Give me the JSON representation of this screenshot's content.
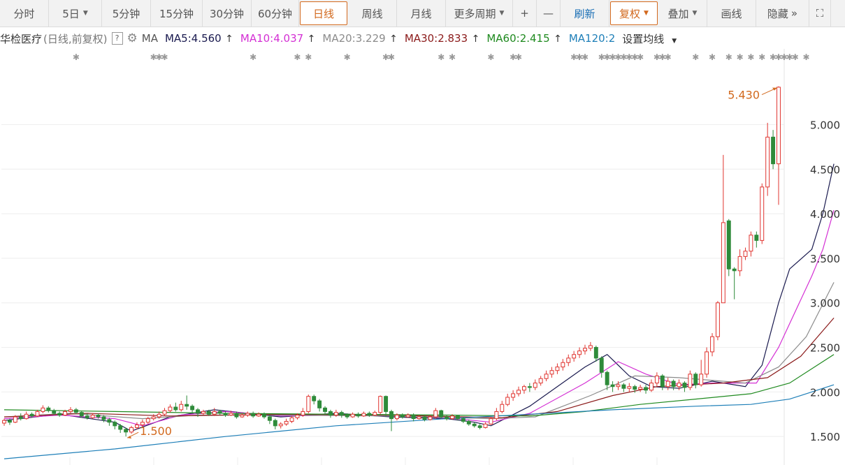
{
  "toolbar": {
    "items": [
      {
        "label": "分时",
        "name": "tab-intraday",
        "caret": false
      },
      {
        "label": "5日",
        "name": "tab-5day",
        "caret": true
      },
      {
        "label": "5分钟",
        "name": "tab-5min",
        "caret": false
      },
      {
        "label": "15分钟",
        "name": "tab-15min",
        "caret": false
      },
      {
        "label": "30分钟",
        "name": "tab-30min",
        "caret": false
      },
      {
        "label": "60分钟",
        "name": "tab-60min",
        "caret": false
      },
      {
        "label": "日线",
        "name": "tab-daily",
        "caret": false,
        "active": true
      },
      {
        "label": "周线",
        "name": "tab-weekly",
        "caret": false
      },
      {
        "label": "月线",
        "name": "tab-monthly",
        "caret": false
      },
      {
        "label": "更多周期",
        "name": "more-periods-dropdown",
        "caret": true
      },
      {
        "label": "+",
        "name": "zoom-in-button",
        "caret": false
      },
      {
        "label": "—",
        "name": "zoom-out-button",
        "caret": false
      },
      {
        "label": "刷新",
        "name": "refresh-button",
        "caret": false,
        "blue": true
      },
      {
        "label": "复权",
        "name": "adjust-dropdown",
        "caret": true,
        "fq": true
      },
      {
        "label": "叠加",
        "name": "overlay-dropdown",
        "caret": true
      },
      {
        "label": "画线",
        "name": "draw-line-button",
        "caret": false
      },
      {
        "label": "隐藏",
        "name": "hide-button",
        "caret": false,
        "chevron": "»"
      },
      {
        "label": "⛶",
        "name": "fullscreen-icon",
        "caret": false
      }
    ]
  },
  "indicator_bar": {
    "stock_name": "华检医疗",
    "mode": "(日线,前复权)",
    "help": "?",
    "ma_label": "MA",
    "ma_items": [
      {
        "text": "MA5:4.560",
        "color": "#1a1a4f",
        "arrow": "↑"
      },
      {
        "text": "MA10:4.037",
        "color": "#d42fd4",
        "arrow": "↑"
      },
      {
        "text": "MA20:3.229",
        "color": "#8c8c8c",
        "arrow": "↑"
      },
      {
        "text": "MA30:2.833",
        "color": "#8b1a1a",
        "arrow": "↑"
      },
      {
        "text": "MA60:2.415",
        "color": "#1f8a1f",
        "arrow": "↑"
      },
      {
        "text": "MA120:2",
        "color": "#1e7fb8",
        "arrow": ""
      }
    ],
    "settings_label": "设置均线"
  },
  "chart_data": {
    "type": "candlestick",
    "ylim": [
      1.18,
      5.85
    ],
    "yticks": [
      "1.500",
      "2.000",
      "2.500",
      "3.000",
      "3.500",
      "4.000",
      "4.500",
      "5.000"
    ],
    "high_label": "5.430",
    "low_label": "1.500",
    "colors": {
      "up": "#e0342f",
      "down": "#2e8b3a",
      "doji": "#333333"
    },
    "candles": [
      [
        1.65,
        1.68,
        1.62,
        1.7
      ],
      [
        1.68,
        1.66,
        1.63,
        1.7
      ],
      [
        1.66,
        1.72,
        1.65,
        1.74
      ],
      [
        1.72,
        1.7,
        1.68,
        1.76
      ],
      [
        1.7,
        1.75,
        1.69,
        1.78
      ],
      [
        1.75,
        1.73,
        1.71,
        1.77
      ],
      [
        1.73,
        1.78,
        1.72,
        1.8
      ],
      [
        1.78,
        1.82,
        1.76,
        1.85
      ],
      [
        1.82,
        1.79,
        1.77,
        1.84
      ],
      [
        1.79,
        1.76,
        1.74,
        1.81
      ],
      [
        1.76,
        1.74,
        1.72,
        1.78
      ],
      [
        1.74,
        1.78,
        1.73,
        1.8
      ],
      [
        1.78,
        1.8,
        1.76,
        1.83
      ],
      [
        1.8,
        1.77,
        1.75,
        1.82
      ],
      [
        1.77,
        1.73,
        1.71,
        1.79
      ],
      [
        1.73,
        1.71,
        1.69,
        1.76
      ],
      [
        1.71,
        1.74,
        1.7,
        1.76
      ],
      [
        1.74,
        1.72,
        1.7,
        1.76
      ],
      [
        1.72,
        1.69,
        1.66,
        1.74
      ],
      [
        1.69,
        1.66,
        1.62,
        1.71
      ],
      [
        1.66,
        1.62,
        1.58,
        1.68
      ],
      [
        1.62,
        1.58,
        1.54,
        1.64
      ],
      [
        1.58,
        1.55,
        1.5,
        1.6
      ],
      [
        1.55,
        1.6,
        1.53,
        1.62
      ],
      [
        1.6,
        1.63,
        1.58,
        1.66
      ],
      [
        1.63,
        1.66,
        1.61,
        1.69
      ],
      [
        1.66,
        1.7,
        1.64,
        1.72
      ],
      [
        1.7,
        1.72,
        1.68,
        1.75
      ],
      [
        1.72,
        1.75,
        1.7,
        1.78
      ],
      [
        1.75,
        1.79,
        1.73,
        1.82
      ],
      [
        1.79,
        1.83,
        1.77,
        1.86
      ],
      [
        1.83,
        1.8,
        1.78,
        1.88
      ],
      [
        1.8,
        1.86,
        1.78,
        1.9
      ],
      [
        1.86,
        1.84,
        1.8,
        1.96
      ],
      [
        1.84,
        1.8,
        1.76,
        1.86
      ],
      [
        1.8,
        1.76,
        1.72,
        1.82
      ],
      [
        1.76,
        1.78,
        1.74,
        1.8
      ],
      [
        1.78,
        1.75,
        1.73,
        1.8
      ],
      [
        1.75,
        1.78,
        1.73,
        1.82
      ],
      [
        1.78,
        1.76,
        1.74,
        1.8
      ],
      [
        1.76,
        1.74,
        1.72,
        1.78
      ],
      [
        1.74,
        1.76,
        1.73,
        1.79
      ],
      [
        1.76,
        1.72,
        1.7,
        1.78
      ],
      [
        1.72,
        1.74,
        1.71,
        1.76
      ],
      [
        1.74,
        1.76,
        1.72,
        1.78
      ],
      [
        1.76,
        1.73,
        1.71,
        1.78
      ],
      [
        1.73,
        1.75,
        1.72,
        1.77
      ],
      [
        1.75,
        1.72,
        1.7,
        1.77
      ],
      [
        1.72,
        1.68,
        1.64,
        1.74
      ],
      [
        1.68,
        1.62,
        1.58,
        1.7
      ],
      [
        1.62,
        1.64,
        1.59,
        1.66
      ],
      [
        1.64,
        1.67,
        1.62,
        1.7
      ],
      [
        1.67,
        1.71,
        1.65,
        1.73
      ],
      [
        1.71,
        1.74,
        1.69,
        1.76
      ],
      [
        1.74,
        1.78,
        1.72,
        1.82
      ],
      [
        1.78,
        1.95,
        1.76,
        1.97
      ],
      [
        1.95,
        1.9,
        1.86,
        1.97
      ],
      [
        1.9,
        1.82,
        1.78,
        1.92
      ],
      [
        1.82,
        1.78,
        1.75,
        1.84
      ],
      [
        1.78,
        1.74,
        1.71,
        1.8
      ],
      [
        1.74,
        1.77,
        1.72,
        1.8
      ],
      [
        1.77,
        1.74,
        1.71,
        1.79
      ],
      [
        1.74,
        1.72,
        1.7,
        1.76
      ],
      [
        1.72,
        1.75,
        1.71,
        1.77
      ],
      [
        1.75,
        1.73,
        1.71,
        1.77
      ],
      [
        1.73,
        1.76,
        1.72,
        1.78
      ],
      [
        1.76,
        1.74,
        1.72,
        1.78
      ],
      [
        1.74,
        1.77,
        1.73,
        1.79
      ],
      [
        1.77,
        1.95,
        1.75,
        1.96
      ],
      [
        1.95,
        1.78,
        1.72,
        1.96
      ],
      [
        1.78,
        1.7,
        1.56,
        1.8
      ],
      [
        1.7,
        1.74,
        1.68,
        1.76
      ],
      [
        1.74,
        1.72,
        1.7,
        1.76
      ],
      [
        1.72,
        1.74,
        1.71,
        1.76
      ],
      [
        1.74,
        1.7,
        1.67,
        1.76
      ],
      [
        1.7,
        1.72,
        1.69,
        1.74
      ],
      [
        1.72,
        1.69,
        1.67,
        1.74
      ],
      [
        1.69,
        1.72,
        1.68,
        1.74
      ],
      [
        1.72,
        1.79,
        1.7,
        1.82
      ],
      [
        1.79,
        1.72,
        1.7,
        1.8
      ],
      [
        1.72,
        1.7,
        1.68,
        1.74
      ],
      [
        1.7,
        1.73,
        1.69,
        1.75
      ],
      [
        1.73,
        1.7,
        1.68,
        1.74
      ],
      [
        1.7,
        1.67,
        1.65,
        1.72
      ],
      [
        1.67,
        1.64,
        1.62,
        1.69
      ],
      [
        1.64,
        1.62,
        1.6,
        1.66
      ],
      [
        1.62,
        1.6,
        1.58,
        1.64
      ],
      [
        1.6,
        1.64,
        1.59,
        1.66
      ],
      [
        1.64,
        1.7,
        1.63,
        1.72
      ],
      [
        1.7,
        1.78,
        1.68,
        1.82
      ],
      [
        1.78,
        1.86,
        1.76,
        1.9
      ],
      [
        1.86,
        1.94,
        1.84,
        1.98
      ],
      [
        1.94,
        1.98,
        1.9,
        2.02
      ],
      [
        1.98,
        2.02,
        1.95,
        2.06
      ],
      [
        2.02,
        2.06,
        1.98,
        2.08
      ],
      [
        2.06,
        2.05,
        2.0,
        2.1
      ],
      [
        2.05,
        2.1,
        2.02,
        2.14
      ],
      [
        2.1,
        2.15,
        2.07,
        2.18
      ],
      [
        2.15,
        2.2,
        2.12,
        2.24
      ],
      [
        2.2,
        2.24,
        2.16,
        2.28
      ],
      [
        2.24,
        2.28,
        2.2,
        2.32
      ],
      [
        2.28,
        2.33,
        2.24,
        2.37
      ],
      [
        2.33,
        2.38,
        2.29,
        2.42
      ],
      [
        2.38,
        2.42,
        2.34,
        2.46
      ],
      [
        2.42,
        2.46,
        2.38,
        2.5
      ],
      [
        2.46,
        2.49,
        2.42,
        2.53
      ],
      [
        2.49,
        2.52,
        2.46,
        2.56
      ],
      [
        2.5,
        2.38,
        2.34,
        2.52
      ],
      [
        2.38,
        2.22,
        2.16,
        2.4
      ],
      [
        2.22,
        2.08,
        2.02,
        2.24
      ],
      [
        2.08,
        2.06,
        2.0,
        2.12
      ],
      [
        2.06,
        2.08,
        2.02,
        2.12
      ],
      [
        2.08,
        2.04,
        2.0,
        2.1
      ],
      [
        2.04,
        2.06,
        2.0,
        2.1
      ],
      [
        2.06,
        2.03,
        1.99,
        2.08
      ],
      [
        2.03,
        2.05,
        2.0,
        2.08
      ],
      [
        2.05,
        2.02,
        1.98,
        2.08
      ],
      [
        2.02,
        2.1,
        2.0,
        2.14
      ],
      [
        2.1,
        2.18,
        2.06,
        2.22
      ],
      [
        2.18,
        2.06,
        2.02,
        2.2
      ],
      [
        2.06,
        2.12,
        2.02,
        2.16
      ],
      [
        2.12,
        2.06,
        2.02,
        2.14
      ],
      [
        2.06,
        2.1,
        2.02,
        2.14
      ],
      [
        2.1,
        2.05,
        2.0,
        2.12
      ],
      [
        2.05,
        2.2,
        2.02,
        2.24
      ],
      [
        2.2,
        2.08,
        2.04,
        2.22
      ],
      [
        2.08,
        2.2,
        2.06,
        2.36
      ],
      [
        2.2,
        2.45,
        2.16,
        2.5
      ],
      [
        2.45,
        2.62,
        2.4,
        2.66
      ],
      [
        2.62,
        3.0,
        2.58,
        3.02
      ],
      [
        3.0,
        3.9,
        3.2,
        4.66
      ],
      [
        3.92,
        3.38,
        3.3,
        3.94
      ],
      [
        3.38,
        3.36,
        3.04,
        3.4
      ],
      [
        3.36,
        3.52,
        3.3,
        3.6
      ],
      [
        3.52,
        3.58,
        3.48,
        3.62
      ],
      [
        3.58,
        3.76,
        3.52,
        3.8
      ],
      [
        3.76,
        3.7,
        3.62,
        3.8
      ],
      [
        3.7,
        4.3,
        3.66,
        4.34
      ],
      [
        4.3,
        4.86,
        4.2,
        5.02
      ],
      [
        4.86,
        4.56,
        4.5,
        4.94
      ],
      [
        4.56,
        5.42,
        4.1,
        5.43
      ]
    ],
    "ma": {
      "MA5": {
        "color": "#1a1a4f",
        "points": [
          [
            0,
            1.68
          ],
          [
            10,
            1.75
          ],
          [
            20,
            1.66
          ],
          [
            23,
            1.56
          ],
          [
            30,
            1.72
          ],
          [
            38,
            1.8
          ],
          [
            50,
            1.72
          ],
          [
            60,
            1.76
          ],
          [
            70,
            1.72
          ],
          [
            80,
            1.7
          ],
          [
            85,
            1.66
          ],
          [
            88,
            1.62
          ],
          [
            95,
            1.84
          ],
          [
            105,
            2.28
          ],
          [
            109,
            2.42
          ],
          [
            113,
            2.18
          ],
          [
            117,
            2.06
          ],
          [
            122,
            2.04
          ],
          [
            128,
            2.12
          ],
          [
            134,
            2.06
          ],
          [
            137,
            2.3
          ],
          [
            140,
            3.0
          ],
          [
            142,
            3.38
          ],
          [
            146,
            3.6
          ],
          [
            148,
            4.0
          ],
          [
            150,
            4.56
          ]
        ]
      },
      "MA10": {
        "color": "#d42fd4",
        "points": [
          [
            0,
            1.7
          ],
          [
            10,
            1.74
          ],
          [
            20,
            1.7
          ],
          [
            25,
            1.62
          ],
          [
            32,
            1.74
          ],
          [
            40,
            1.78
          ],
          [
            50,
            1.73
          ],
          [
            60,
            1.74
          ],
          [
            70,
            1.73
          ],
          [
            80,
            1.71
          ],
          [
            88,
            1.66
          ],
          [
            95,
            1.76
          ],
          [
            105,
            2.1
          ],
          [
            111,
            2.34
          ],
          [
            116,
            2.2
          ],
          [
            122,
            2.08
          ],
          [
            128,
            2.1
          ],
          [
            136,
            2.1
          ],
          [
            140,
            2.5
          ],
          [
            143,
            2.9
          ],
          [
            146,
            3.3
          ],
          [
            148,
            3.6
          ],
          [
            150,
            4.04
          ]
        ]
      },
      "MA20": {
        "color": "#8c8c8c",
        "points": [
          [
            0,
            1.72
          ],
          [
            12,
            1.76
          ],
          [
            25,
            1.7
          ],
          [
            35,
            1.74
          ],
          [
            50,
            1.74
          ],
          [
            70,
            1.73
          ],
          [
            88,
            1.7
          ],
          [
            96,
            1.72
          ],
          [
            106,
            1.96
          ],
          [
            114,
            2.18
          ],
          [
            122,
            2.16
          ],
          [
            134,
            2.1
          ],
          [
            140,
            2.28
          ],
          [
            145,
            2.62
          ],
          [
            150,
            3.23
          ]
        ]
      },
      "MA30": {
        "color": "#8b1a1a",
        "points": [
          [
            0,
            1.72
          ],
          [
            15,
            1.76
          ],
          [
            30,
            1.73
          ],
          [
            50,
            1.75
          ],
          [
            70,
            1.74
          ],
          [
            90,
            1.71
          ],
          [
            100,
            1.78
          ],
          [
            110,
            1.96
          ],
          [
            118,
            2.06
          ],
          [
            130,
            2.1
          ],
          [
            138,
            2.16
          ],
          [
            144,
            2.4
          ],
          [
            150,
            2.83
          ]
        ]
      },
      "MA60": {
        "color": "#1f8a1f",
        "points": [
          [
            0,
            1.8
          ],
          [
            20,
            1.78
          ],
          [
            40,
            1.76
          ],
          [
            60,
            1.75
          ],
          [
            80,
            1.74
          ],
          [
            95,
            1.73
          ],
          [
            105,
            1.78
          ],
          [
            115,
            1.86
          ],
          [
            125,
            1.92
          ],
          [
            135,
            1.98
          ],
          [
            142,
            2.1
          ],
          [
            150,
            2.42
          ]
        ]
      },
      "MA120": {
        "color": "#1e7fb8",
        "points": [
          [
            0,
            1.25
          ],
          [
            20,
            1.36
          ],
          [
            40,
            1.5
          ],
          [
            60,
            1.62
          ],
          [
            80,
            1.7
          ],
          [
            95,
            1.75
          ],
          [
            110,
            1.8
          ],
          [
            125,
            1.84
          ],
          [
            135,
            1.86
          ],
          [
            142,
            1.92
          ],
          [
            150,
            2.08
          ]
        ]
      }
    }
  }
}
